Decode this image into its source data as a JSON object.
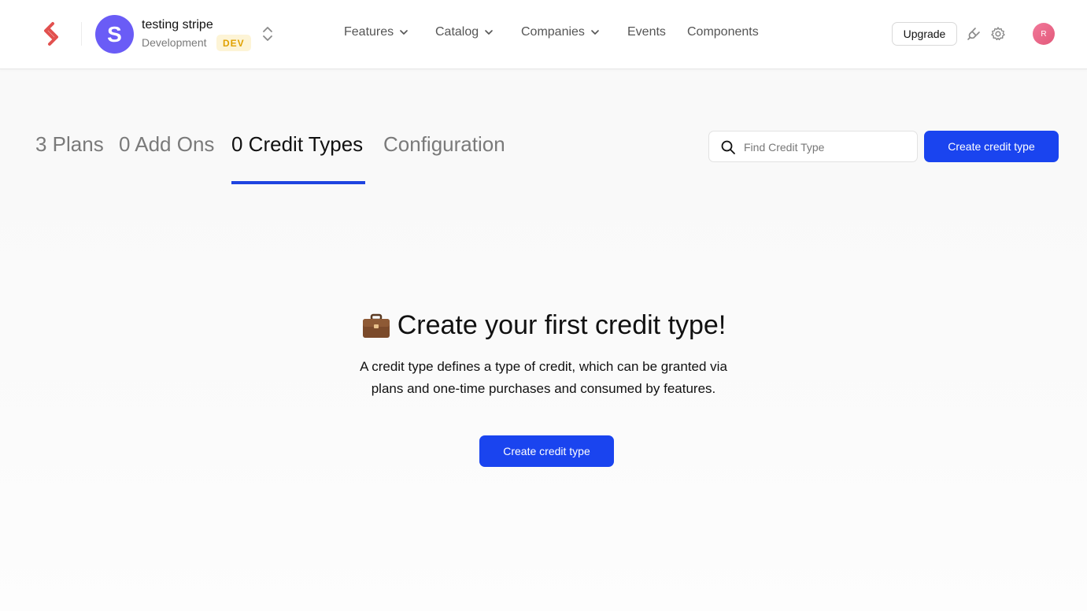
{
  "header": {
    "account_initial": "S",
    "account_name": "testing stripe",
    "account_env": "Development",
    "env_badge": "DEV",
    "nav": [
      {
        "label": "Features",
        "has_dropdown": true
      },
      {
        "label": "Catalog",
        "has_dropdown": true
      },
      {
        "label": "Companies",
        "has_dropdown": true
      },
      {
        "label": "Events",
        "has_dropdown": false
      },
      {
        "label": "Components",
        "has_dropdown": false
      }
    ],
    "upgrade_label": "Upgrade",
    "user_initial": "R"
  },
  "tabs": [
    {
      "label": "3 Plans",
      "active": false
    },
    {
      "label": "0 Add Ons",
      "active": false
    },
    {
      "label": "0 Credit Types",
      "active": true
    },
    {
      "label": "Configuration",
      "active": false
    }
  ],
  "search": {
    "placeholder": "Find Credit Type",
    "value": ""
  },
  "create_button_label": "Create credit type",
  "empty_state": {
    "title": "Create your first credit type!",
    "description_line1": "A credit type defines a type of credit, which can be granted via",
    "description_line2": "plans and one-time purchases and consumed by features.",
    "button_label": "Create credit type"
  },
  "colors": {
    "accent": "#1a44ef",
    "brand_logo": "#e2514f",
    "account_avatar": "#6a5cf6"
  }
}
